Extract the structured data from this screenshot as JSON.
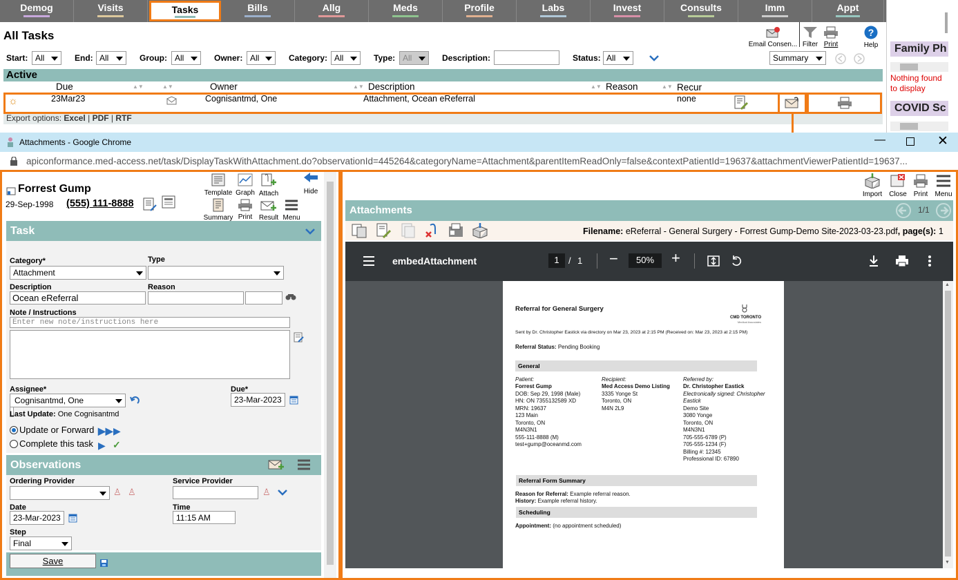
{
  "tabs": [
    {
      "label": "Demog",
      "color": "#c8a8dc"
    },
    {
      "label": "Visits",
      "color": "#dcc89c"
    },
    {
      "label": "Tasks",
      "color": "#8fbcb8",
      "selected": true
    },
    {
      "label": "Bills",
      "color": "#9cb0cc"
    },
    {
      "label": "Allg",
      "color": "#e09898"
    },
    {
      "label": "Meds",
      "color": "#8fc48f"
    },
    {
      "label": "Profile",
      "color": "#e0b090"
    },
    {
      "label": "Labs",
      "color": "#b0c8d8"
    },
    {
      "label": "Invest",
      "color": "#d890a8"
    },
    {
      "label": "Consults",
      "color": "#b8cc98"
    },
    {
      "label": "Imm",
      "color": "#ccc"
    },
    {
      "label": "Appt",
      "color": "#98c8c0"
    }
  ],
  "right_pane": {
    "family_title": "Family Ph",
    "family_empty": "Nothing found to display",
    "covid_title": "COVID Sc"
  },
  "all_tasks": {
    "title": "All Tasks",
    "toolbar": {
      "email_consent": "Email Consen...",
      "filter": "Filter",
      "print": "Print",
      "help": "Help"
    },
    "filters": {
      "start_label": "Start:",
      "start_value": "All",
      "end_label": "End:",
      "end_value": "All",
      "group_label": "Group:",
      "group_value": "All",
      "owner_label": "Owner:",
      "owner_value": "All",
      "category_label": "Category:",
      "category_value": "All",
      "type_label": "Type:",
      "type_value": "All",
      "description_label": "Description:",
      "description_value": "",
      "status_label": "Status:",
      "status_value": "All",
      "view_value": "Summary"
    },
    "active_title": "Active",
    "columns": {
      "due": "Due",
      "owner": "Owner",
      "description": "Description",
      "reason": "Reason",
      "recur": "Recur"
    },
    "row": {
      "due": "23Mar23",
      "owner": "Cognisantmd, One",
      "description": "Attachment, Ocean eReferral",
      "reason": "",
      "recur": "none"
    },
    "export": {
      "label": "Export options:",
      "excel": "Excel",
      "pdf": "PDF",
      "rtf": "RTF",
      "sep": "|"
    }
  },
  "chrome": {
    "title": "Attachments - Google Chrome",
    "url": "apiconformance.med-access.net/task/DisplayTaskWithAttachment.do?observationId=445264&categoryName=Attachment&parentItemReadOnly=false&contextPatientId=19637&attachmentViewerPatientId=19637..."
  },
  "patient": {
    "name": "Forrest Gump",
    "dob": "29-Sep-1998",
    "phone": "(555) 111-8888"
  },
  "left_toolbar": {
    "template": "Template",
    "graph": "Graph",
    "attach": "Attach",
    "hide": "Hide",
    "summary": "Summary",
    "print": "Print",
    "result": "Result",
    "menu": "Menu"
  },
  "task": {
    "title": "Task",
    "category_label": "Category*",
    "category_value": "Attachment",
    "type_label": "Type",
    "type_value": "",
    "description_label": "Description",
    "description_value": "Ocean eReferral",
    "reason_label": "Reason",
    "reason_value": "",
    "note_label": "Note / Instructions",
    "note_placeholder": "Enter new note/instructions here",
    "assignee_label": "Assignee*",
    "assignee_value": "Cognisantmd, One",
    "due_label": "Due*",
    "due_value": "23-Mar-2023",
    "last_update": "Last Update:",
    "last_update_value": "One Cognisantmd",
    "update_forward": "Update or Forward",
    "complete": "Complete this task"
  },
  "observations": {
    "title": "Observations",
    "ordering_label": "Ordering Provider",
    "ordering_value": "",
    "service_label": "Service Provider",
    "service_value": "",
    "date_label": "Date",
    "date_value": "23-Mar-2023",
    "time_label": "Time",
    "time_value": "11:15 AM",
    "step_label": "Step",
    "step_value": "Final",
    "save": "Save"
  },
  "attachments": {
    "toolbar": {
      "import": "Import",
      "close": "Close",
      "print": "Print",
      "menu": "Menu"
    },
    "title": "Attachments",
    "page_counter": "1/1",
    "filename_label": "Filename:",
    "filename_value": "eReferral - General Surgery - Forrest Gump-Demo Site-2023-03-23.pdf",
    "pages_label": ", page(s):",
    "pages_value": "1"
  },
  "pdf_viewer": {
    "doc_title": "embedAttachment",
    "page": "1",
    "total": "1",
    "zoom": "50%",
    "content": {
      "heading": "Referral for General Surgery",
      "logo_text": "CMD TORONTO",
      "logo_sub": "Medical Associates",
      "sent_by": "Sent by Dr. Christopher Eastick via directory on Mar 23, 2023 at 2:15 PM (Received on: Mar 23, 2023 at 2:15 PM)",
      "status_label": "Referral Status:",
      "status_value": "Pending Booking",
      "general": "General",
      "patient_label": "Patient:",
      "patient_lines": [
        "Forrest Gump",
        "DOB: Sep 29, 1998    (Male)",
        "HN: ON 7355132589 XD",
        "MRN: 19637",
        "123 Main",
        "Toronto, ON",
        "M4N3N1",
        "555-111-8888 (M)",
        "test+gump@oceanmd.com"
      ],
      "recipient_label": "Recipient:",
      "recipient_lines": [
        "Med Access Demo Listing",
        "3335 Yonge St",
        "Toronto, ON",
        "M4N 2L9"
      ],
      "referred_label": "Referred by:",
      "referred_lines": [
        "Dr. Christopher Eastick",
        "Electronically signed: Christopher",
        "Eastick",
        "Demo Site",
        "3080 Yonge",
        "Toronto, ON",
        "M4N3N1",
        "705-555-6789 (P)",
        "705-555-1234 (F)",
        "Billing #: 12345",
        "Professional ID: 67890"
      ],
      "summary": "Referral Form Summary",
      "reason_label": "Reason for Referral:",
      "reason_value": "Example referral reason.",
      "history_label": "History:",
      "history_value": "Example referral history.",
      "scheduling": "Scheduling",
      "appointment_label": "Appointment:",
      "appointment_value": "(no appointment scheduled)"
    }
  }
}
